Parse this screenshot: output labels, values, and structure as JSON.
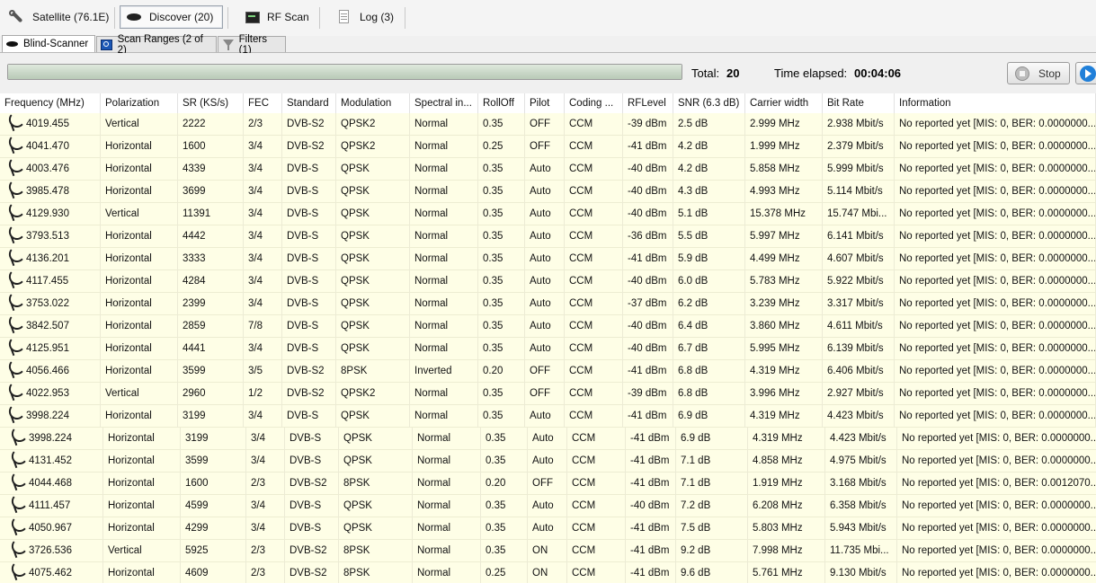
{
  "toolbar": {
    "satellite": "Satellite (76.1E)",
    "discover": "Discover (20)",
    "rfscan": "RF Scan",
    "log": "Log (3)"
  },
  "subtabs": {
    "blind": "Blind-Scanner",
    "ranges": "Scan Ranges (2 of 2)",
    "filters": "Filters (1)"
  },
  "status": {
    "total_label": "Total:",
    "total_value": "20",
    "elapsed_label": "Time elapsed:",
    "elapsed_value": "00:04:06",
    "stop_label": "Stop"
  },
  "table": {
    "columns": [
      "Frequency (MHz)",
      "Polarization",
      "SR (KS/s)",
      "FEC",
      "Standard",
      "Modulation",
      "Spectral in...",
      "RollOff",
      "Pilot",
      "Coding ...",
      "RFLevel",
      "SNR (6.3 dB)",
      "Carrier width",
      "Bit Rate",
      "Information"
    ],
    "rows": [
      [
        "4019.455",
        "Vertical",
        "2222",
        "2/3",
        "DVB-S2",
        "QPSK2",
        "Normal",
        "0.35",
        "OFF",
        "CCM",
        "-39 dBm",
        "2.5 dB",
        "2.999 MHz",
        "2.938 Mbit/s",
        "No reported yet [MIS: 0, BER: 0.0000000..."
      ],
      [
        "4041.470",
        "Horizontal",
        "1600",
        "3/4",
        "DVB-S2",
        "QPSK2",
        "Normal",
        "0.25",
        "OFF",
        "CCM",
        "-41 dBm",
        "4.2 dB",
        "1.999 MHz",
        "2.379 Mbit/s",
        "No reported yet [MIS: 0, BER: 0.0000000..."
      ],
      [
        "4003.476",
        "Horizontal",
        "4339",
        "3/4",
        "DVB-S",
        "QPSK",
        "Normal",
        "0.35",
        "Auto",
        "CCM",
        "-40 dBm",
        "4.2 dB",
        "5.858 MHz",
        "5.999 Mbit/s",
        "No reported yet [MIS: 0, BER: 0.0000000..."
      ],
      [
        "3985.478",
        "Horizontal",
        "3699",
        "3/4",
        "DVB-S",
        "QPSK",
        "Normal",
        "0.35",
        "Auto",
        "CCM",
        "-40 dBm",
        "4.3 dB",
        "4.993 MHz",
        "5.114 Mbit/s",
        "No reported yet [MIS: 0, BER: 0.0000000..."
      ],
      [
        "4129.930",
        "Vertical",
        "11391",
        "3/4",
        "DVB-S",
        "QPSK",
        "Normal",
        "0.35",
        "Auto",
        "CCM",
        "-40 dBm",
        "5.1 dB",
        "15.378 MHz",
        "15.747 Mbi...",
        "No reported yet [MIS: 0, BER: 0.0000000..."
      ],
      [
        "3793.513",
        "Horizontal",
        "4442",
        "3/4",
        "DVB-S",
        "QPSK",
        "Normal",
        "0.35",
        "Auto",
        "CCM",
        "-36 dBm",
        "5.5 dB",
        "5.997 MHz",
        "6.141 Mbit/s",
        "No reported yet [MIS: 0, BER: 0.0000000..."
      ],
      [
        "4136.201",
        "Horizontal",
        "3333",
        "3/4",
        "DVB-S",
        "QPSK",
        "Normal",
        "0.35",
        "Auto",
        "CCM",
        "-41 dBm",
        "5.9 dB",
        "4.499 MHz",
        "4.607 Mbit/s",
        "No reported yet [MIS: 0, BER: 0.0000000..."
      ],
      [
        "4117.455",
        "Horizontal",
        "4284",
        "3/4",
        "DVB-S",
        "QPSK",
        "Normal",
        "0.35",
        "Auto",
        "CCM",
        "-40 dBm",
        "6.0 dB",
        "5.783 MHz",
        "5.922 Mbit/s",
        "No reported yet [MIS: 0, BER: 0.0000000..."
      ],
      [
        "3753.022",
        "Horizontal",
        "2399",
        "3/4",
        "DVB-S",
        "QPSK",
        "Normal",
        "0.35",
        "Auto",
        "CCM",
        "-37 dBm",
        "6.2 dB",
        "3.239 MHz",
        "3.317 Mbit/s",
        "No reported yet [MIS: 0, BER: 0.0000000..."
      ],
      [
        "3842.507",
        "Horizontal",
        "2859",
        "7/8",
        "DVB-S",
        "QPSK",
        "Normal",
        "0.35",
        "Auto",
        "CCM",
        "-40 dBm",
        "6.4 dB",
        "3.860 MHz",
        "4.611 Mbit/s",
        "No reported yet [MIS: 0, BER: 0.0000000..."
      ],
      [
        "4125.951",
        "Horizontal",
        "4441",
        "3/4",
        "DVB-S",
        "QPSK",
        "Normal",
        "0.35",
        "Auto",
        "CCM",
        "-40 dBm",
        "6.7 dB",
        "5.995 MHz",
        "6.139 Mbit/s",
        "No reported yet [MIS: 0, BER: 0.0000000..."
      ],
      [
        "4056.466",
        "Horizontal",
        "3599",
        "3/5",
        "DVB-S2",
        "8PSK",
        "Inverted",
        "0.20",
        "OFF",
        "CCM",
        "-41 dBm",
        "6.8 dB",
        "4.319 MHz",
        "6.406 Mbit/s",
        "No reported yet [MIS: 0, BER: 0.0000000..."
      ],
      [
        "4022.953",
        "Vertical",
        "2960",
        "1/2",
        "DVB-S2",
        "QPSK2",
        "Normal",
        "0.35",
        "OFF",
        "CCM",
        "-39 dBm",
        "6.8 dB",
        "3.996 MHz",
        "2.927 Mbit/s",
        "No reported yet [MIS: 0, BER: 0.0000000..."
      ],
      [
        "3998.224",
        "Horizontal",
        "3199",
        "3/4",
        "DVB-S",
        "QPSK",
        "Normal",
        "0.35",
        "Auto",
        "CCM",
        "-41 dBm",
        "6.9 dB",
        "4.319 MHz",
        "4.423 Mbit/s",
        "No reported yet [MIS: 0, BER: 0.0000000..."
      ],
      [
        "3998.224",
        "Horizontal",
        "3199",
        "3/4",
        "DVB-S",
        "QPSK",
        "Normal",
        "0.35",
        "Auto",
        "CCM",
        "-41 dBm",
        "6.9 dB",
        "4.319 MHz",
        "4.423 Mbit/s",
        "No reported yet [MIS: 0, BER: 0.0000000..."
      ],
      [
        "4131.452",
        "Horizontal",
        "3599",
        "3/4",
        "DVB-S",
        "QPSK",
        "Normal",
        "0.35",
        "Auto",
        "CCM",
        "-41 dBm",
        "7.1 dB",
        "4.858 MHz",
        "4.975 Mbit/s",
        "No reported yet [MIS: 0, BER: 0.0000000..."
      ],
      [
        "4044.468",
        "Horizontal",
        "1600",
        "2/3",
        "DVB-S2",
        "8PSK",
        "Normal",
        "0.20",
        "OFF",
        "CCM",
        "-41 dBm",
        "7.1 dB",
        "1.919 MHz",
        "3.168 Mbit/s",
        "No reported yet [MIS: 0, BER: 0.0012070..."
      ],
      [
        "4111.457",
        "Horizontal",
        "4599",
        "3/4",
        "DVB-S",
        "QPSK",
        "Normal",
        "0.35",
        "Auto",
        "CCM",
        "-40 dBm",
        "7.2 dB",
        "6.208 MHz",
        "6.358 Mbit/s",
        "No reported yet [MIS: 0, BER: 0.0000000..."
      ],
      [
        "4050.967",
        "Horizontal",
        "4299",
        "3/4",
        "DVB-S",
        "QPSK",
        "Normal",
        "0.35",
        "Auto",
        "CCM",
        "-41 dBm",
        "7.5 dB",
        "5.803 MHz",
        "5.943 Mbit/s",
        "No reported yet [MIS: 0, BER: 0.0000000..."
      ],
      [
        "3726.536",
        "Vertical",
        "5925",
        "2/3",
        "DVB-S2",
        "8PSK",
        "Normal",
        "0.35",
        "ON",
        "CCM",
        "-41 dBm",
        "9.2 dB",
        "7.998 MHz",
        "11.735 Mbi...",
        "No reported yet [MIS: 0, BER: 0.0000000..."
      ],
      [
        "4075.462",
        "Horizontal",
        "4609",
        "2/3",
        "DVB-S2",
        "8PSK",
        "Normal",
        "0.25",
        "ON",
        "CCM",
        "-41 dBm",
        "9.6 dB",
        "5.761 MHz",
        "9.130 Mbit/s",
        "No reported yet [MIS: 0, BER: 0.0000000..."
      ]
    ]
  }
}
